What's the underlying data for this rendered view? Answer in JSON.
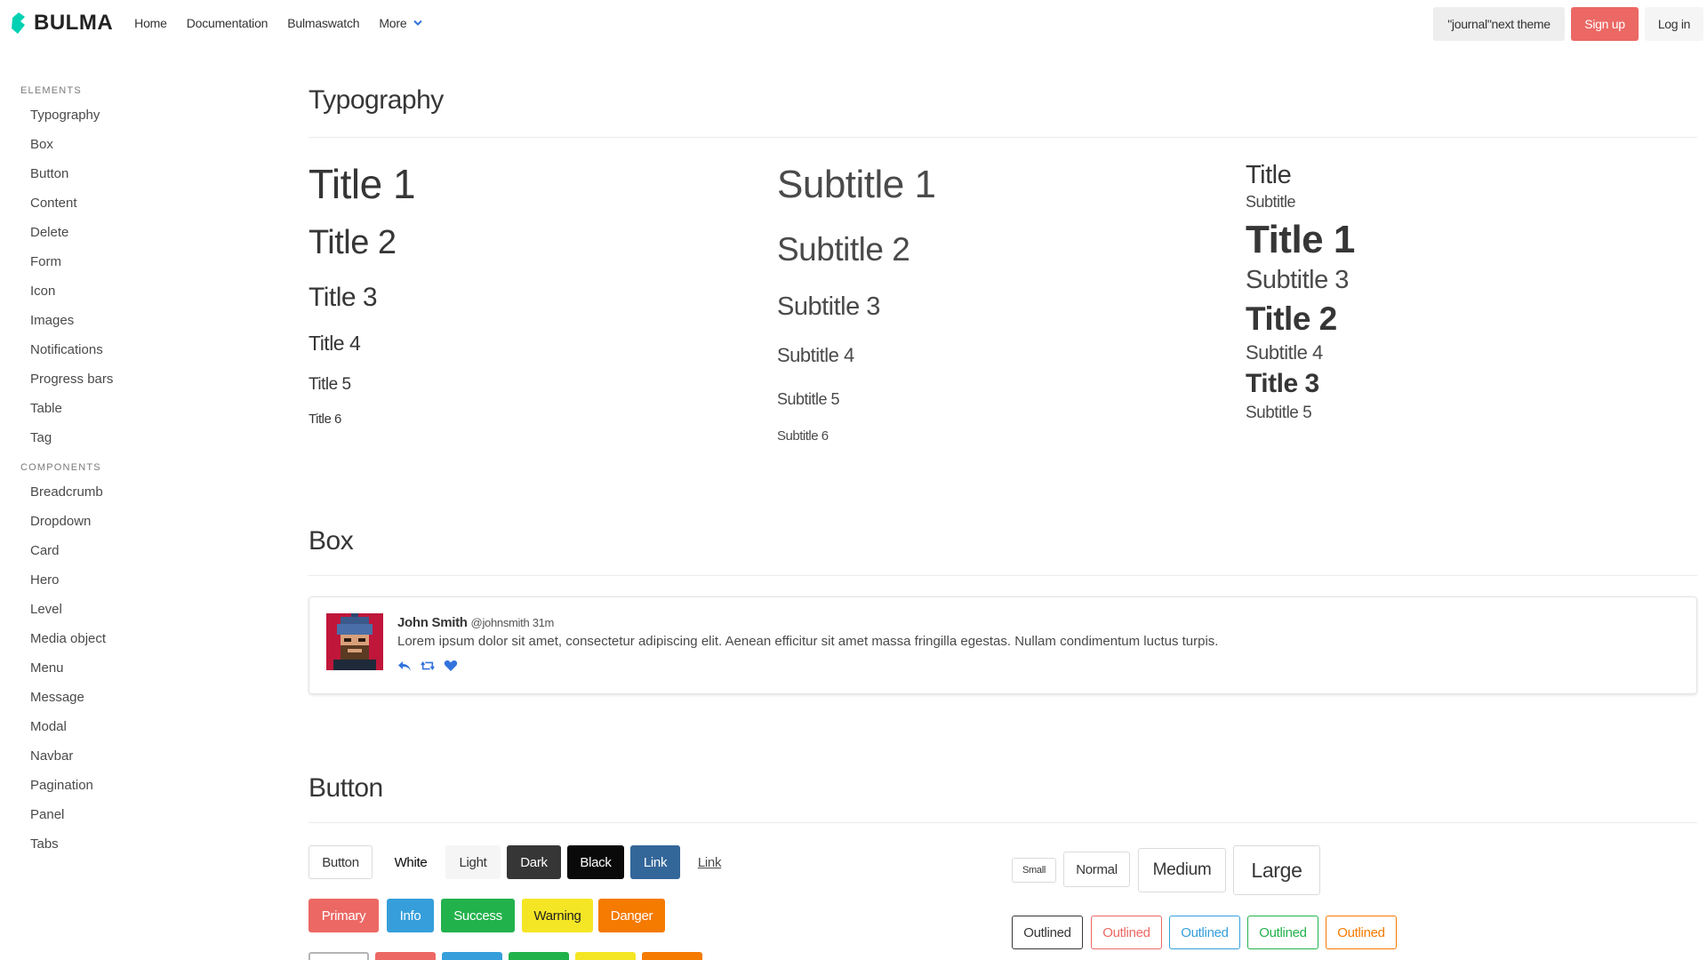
{
  "navbar": {
    "brand": "BULMA",
    "links": [
      "Home",
      "Documentation",
      "Bulmaswatch",
      "More"
    ],
    "theme_button": "\"journal\"next theme",
    "signup": "Sign up",
    "login": "Log in"
  },
  "sidebar": {
    "elements_label": "ELEMENTS",
    "elements": [
      "Typography",
      "Box",
      "Button",
      "Content",
      "Delete",
      "Form",
      "Icon",
      "Images",
      "Notifications",
      "Progress bars",
      "Table",
      "Tag"
    ],
    "components_label": "COMPONENTS",
    "components": [
      "Breadcrumb",
      "Dropdown",
      "Card",
      "Hero",
      "Level",
      "Media object",
      "Menu",
      "Message",
      "Modal",
      "Navbar",
      "Pagination",
      "Panel",
      "Tabs"
    ]
  },
  "typography": {
    "heading": "Typography",
    "titles": [
      "Title 1",
      "Title 2",
      "Title 3",
      "Title 4",
      "Title 5",
      "Title 6"
    ],
    "subtitles": [
      "Subtitle 1",
      "Subtitle 2",
      "Subtitle 3",
      "Subtitle 4",
      "Subtitle 5",
      "Subtitle 6"
    ],
    "combo": [
      "Title",
      "Subtitle",
      "Title 1",
      "Subtitle 3",
      "Title 2",
      "Subtitle 4",
      "Title 3",
      "Subtitle 5"
    ]
  },
  "box": {
    "heading": "Box",
    "name": "John Smith",
    "handle": "@johnsmith 31m",
    "text": "Lorem ipsum dolor sit amet, consectetur adipiscing elit. Aenean efficitur sit amet massa fringilla egestas. Nullam condimentum luctus turpis."
  },
  "button": {
    "heading": "Button",
    "row1": [
      "Button",
      "White",
      "Light",
      "Dark",
      "Black",
      "Link",
      "Link"
    ],
    "row2": [
      "Primary",
      "Info",
      "Success",
      "Warning",
      "Danger"
    ],
    "sizes": [
      "Small",
      "Normal",
      "Medium",
      "Large"
    ],
    "outlined": [
      "Outlined",
      "Outlined",
      "Outlined",
      "Outlined",
      "Outlined"
    ]
  },
  "colors": {
    "primary": "#eb6864",
    "info": "#369fdb",
    "success": "#22b24c",
    "warning": "#f5e625",
    "danger": "#f57a00",
    "link": "#336699",
    "brand": "#00d1b2"
  }
}
